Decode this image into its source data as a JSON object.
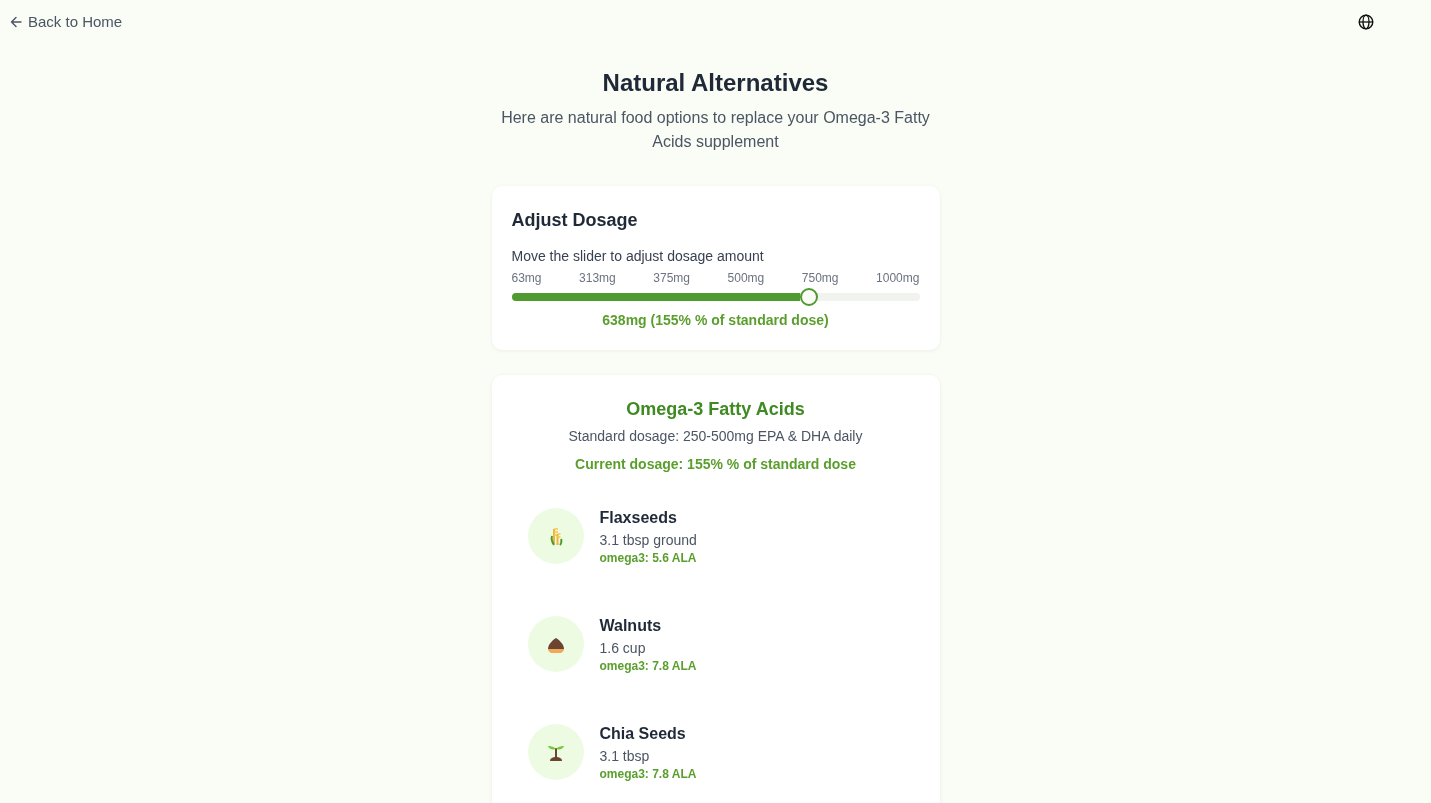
{
  "header": {
    "back_link": "Back to Home"
  },
  "page": {
    "title": "Natural Alternatives",
    "subtitle": "Here are natural food options to replace your Omega-3 Fatty Acids supplement"
  },
  "dosage_card": {
    "title": "Adjust Dosage",
    "hint": "Move the slider to adjust dosage amount",
    "tick_labels": [
      "63mg",
      "313mg",
      "375mg",
      "500mg",
      "750mg",
      "1000mg"
    ],
    "slider": {
      "level": 0.73
    },
    "reading": "638mg (155% % of standard dose)"
  },
  "nutrient_card": {
    "title": "Omega-3 Fatty Acids",
    "standard_dosage": "Standard dosage: 250-500mg EPA & DHA daily",
    "current_dosage": "Current dosage: 155% % of standard dose",
    "foods": [
      {
        "name": "Flaxseeds",
        "amount": "3.1 tbsp ground",
        "nutrient": "omega3: 5.6 ALA"
      },
      {
        "name": "Walnuts",
        "amount": "1.6 cup",
        "nutrient": "omega3: 7.8 ALA"
      },
      {
        "name": "Chia Seeds",
        "amount": "3.1 tbsp",
        "nutrient": "omega3: 7.8 ALA"
      }
    ]
  }
}
